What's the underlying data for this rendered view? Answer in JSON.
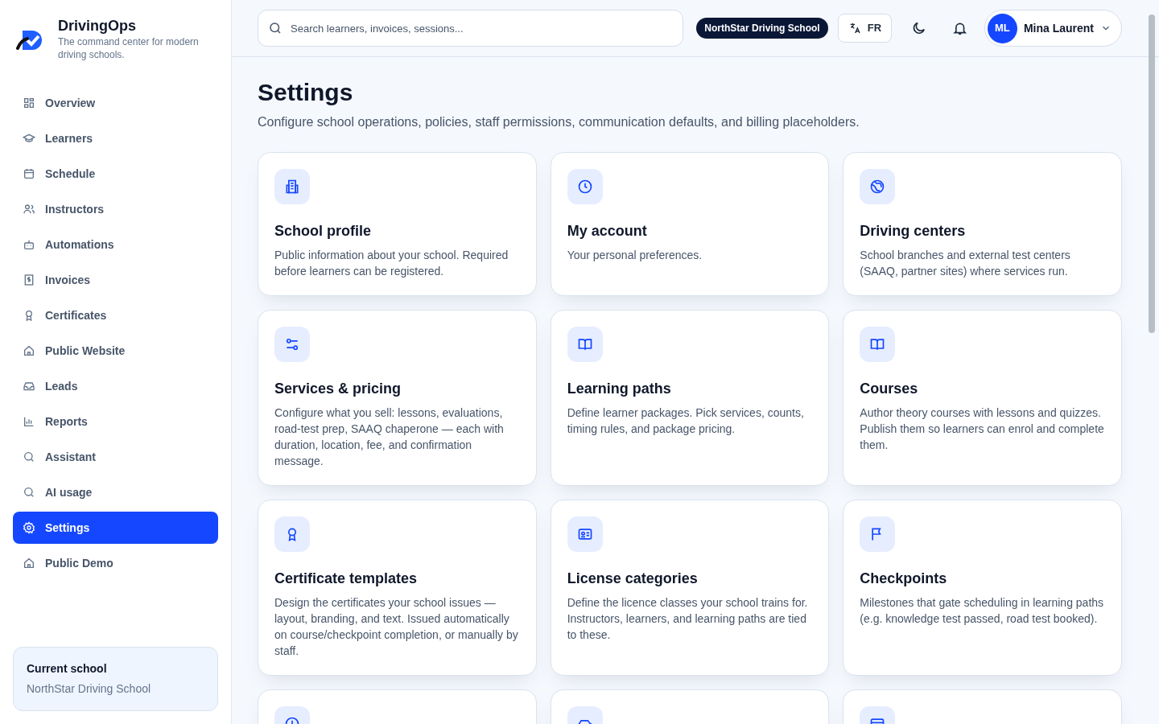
{
  "brand": {
    "name": "DrivingOps",
    "tagline": "The command center for modern driving schools."
  },
  "sidebar": {
    "items": [
      {
        "label": "Overview",
        "selected": false
      },
      {
        "label": "Learners",
        "selected": false
      },
      {
        "label": "Schedule",
        "selected": false
      },
      {
        "label": "Instructors",
        "selected": false
      },
      {
        "label": "Automations",
        "selected": false
      },
      {
        "label": "Invoices",
        "selected": false
      },
      {
        "label": "Certificates",
        "selected": false
      },
      {
        "label": "Public Website",
        "selected": false
      },
      {
        "label": "Leads",
        "selected": false
      },
      {
        "label": "Reports",
        "selected": false
      },
      {
        "label": "Assistant",
        "selected": false
      },
      {
        "label": "AI usage",
        "selected": false
      },
      {
        "label": "Settings",
        "selected": true
      },
      {
        "label": "Public Demo",
        "selected": false
      }
    ]
  },
  "current_school": {
    "label": "Current school",
    "value": "NorthStar Driving School"
  },
  "topbar": {
    "search": {
      "placeholder": "Search learners, invoices, sessions..."
    },
    "school_badge": "NorthStar Driving School",
    "language": "FR",
    "user": {
      "initials": "ML",
      "name": "Mina Laurent"
    }
  },
  "page": {
    "title": "Settings",
    "subtitle": "Configure school operations, policies, staff permissions, communication defaults, and billing placeholders."
  },
  "cards": [
    {
      "title": "School profile",
      "description": "Public information about your school. Required before learners can be registered."
    },
    {
      "title": "My account",
      "description": "Your personal preferences."
    },
    {
      "title": "Driving centers",
      "description": "School branches and external test centers (SAAQ, partner sites) where services run."
    },
    {
      "title": "Services & pricing",
      "description": "Configure what you sell: lessons, evaluations, road-test prep, SAAQ chaperone — each with duration, location, fee, and confirmation message."
    },
    {
      "title": "Learning paths",
      "description": "Define learner packages. Pick services, counts, timing rules, and package pricing."
    },
    {
      "title": "Courses",
      "description": "Author theory courses with lessons and quizzes. Publish them so learners can enrol and complete them."
    },
    {
      "title": "Certificate templates",
      "description": "Design the certificates your school issues — layout, branding, and text. Issued automatically on course/checkpoint completion, or manually by staff."
    },
    {
      "title": "License categories",
      "description": "Define the licence classes your school trains for. Instructors, learners, and learning paths are tied to these."
    },
    {
      "title": "Checkpoints",
      "description": "Milestones that gate scheduling in learning paths (e.g. knowledge test passed, road test booked)."
    }
  ]
}
